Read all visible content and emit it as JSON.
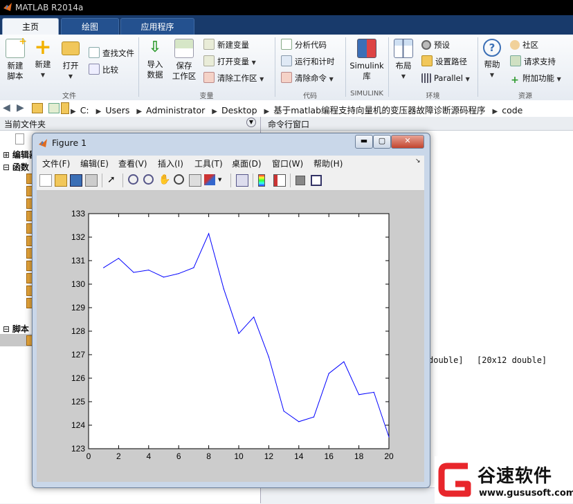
{
  "app": {
    "title": "MATLAB R2014a"
  },
  "tabs": [
    "主页",
    "绘图",
    "应用程序"
  ],
  "ribbon": {
    "file": {
      "new_script": [
        "新建",
        "脚本"
      ],
      "new": "新建",
      "open": "打开",
      "find_files": "查找文件",
      "compare": "比较",
      "group": "文件"
    },
    "variable": {
      "import": [
        "导入",
        "数据"
      ],
      "save": [
        "保存",
        "工作区"
      ],
      "new_var": "新建变量",
      "open_var": "打开变量",
      "clear_ws": "清除工作区",
      "group": "变量"
    },
    "code": {
      "analyze": "分析代码",
      "run_time": "运行和计时",
      "clear_cmd": "清除命令",
      "group": "代码"
    },
    "simulink": {
      "label": [
        "Simulink",
        "库"
      ],
      "group": "SIMULINK"
    },
    "env": {
      "layout": "布局",
      "prefs": "预设",
      "set_path": "设置路径",
      "parallel": "Parallel",
      "group": "环境"
    },
    "resources": {
      "help": "帮助",
      "community": "社区",
      "request_support": "请求支持",
      "addons": "附加功能",
      "group": "资源"
    }
  },
  "address": {
    "crumbs": [
      "C:",
      "Users",
      "Administrator",
      "Desktop",
      "基于matlab编程支持向量机的变压器故障诊断源码程序",
      "code"
    ]
  },
  "left_panel": {
    "header": "当前文件夹",
    "tree_items": [
      "编辑器",
      "函数",
      "脚本"
    ]
  },
  "right_panel": {
    "header": "命令行窗口",
    "workspace_values": [
      "double]",
      "[20x12 double]"
    ]
  },
  "figure": {
    "title": "Figure 1",
    "menu": [
      "文件(F)",
      "编辑(E)",
      "查看(V)",
      "插入(I)",
      "工具(T)",
      "桌面(D)",
      "窗口(W)",
      "帮助(H)"
    ]
  },
  "chart_data": {
    "type": "line",
    "x": [
      1,
      2,
      3,
      4,
      5,
      6,
      7,
      8,
      9,
      10,
      11,
      12,
      13,
      14,
      15,
      16,
      17,
      18,
      19,
      20
    ],
    "series": [
      {
        "values": [
          130.7,
          131.1,
          130.5,
          130.6,
          130.3,
          130.45,
          130.7,
          132.15,
          129.8,
          127.9,
          128.6,
          126.9,
          124.6,
          124.15,
          124.35,
          126.2,
          126.7,
          125.3,
          125.4,
          123.5
        ],
        "color": "#0000ff"
      }
    ],
    "xlim": [
      0,
      20
    ],
    "ylim": [
      123,
      133
    ],
    "xticks": [
      "0",
      "2",
      "4",
      "6",
      "8",
      "10",
      "12",
      "14",
      "16",
      "18",
      "20"
    ],
    "yticks": [
      "123",
      "124",
      "125",
      "126",
      "127",
      "128",
      "129",
      "130",
      "131",
      "132",
      "133"
    ],
    "grid": false
  },
  "watermark": {
    "brand": "谷速软件",
    "url": "www.gususoft.com"
  }
}
